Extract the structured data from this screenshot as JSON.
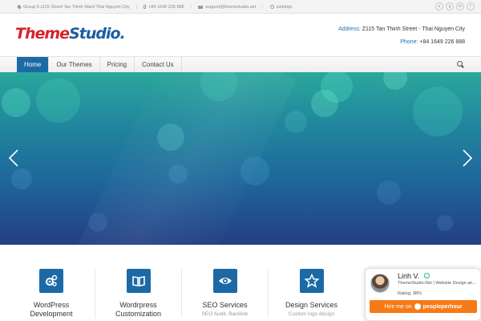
{
  "topbar": {
    "address": "Group 5 z115 Street Tan Thinh Ward Thai Nguyen City",
    "phone": "+84 1649 226 888",
    "email": "support@themestudio.net",
    "skype": "vulinhpc",
    "socials": [
      "skype",
      "google-plus",
      "linkedin",
      "facebook"
    ]
  },
  "header": {
    "logo_part1": "Theme",
    "logo_part2": "Studio.",
    "address_label": "Address:",
    "address_value": "Z115 Tan Thinh Street - Thai Nguyen City",
    "phone_label": "Phone:",
    "phone_value": "+84 1649 226 888"
  },
  "nav": {
    "items": [
      "Home",
      "Our Themes",
      "Pricing",
      "Contact Us"
    ],
    "active": "Home"
  },
  "slider": {
    "prev_icon": "chevron-left-icon",
    "next_icon": "chevron-right-icon"
  },
  "services": [
    {
      "title_line1": "WordPress",
      "title_line2": "Development",
      "desc": "",
      "icon": "gears-icon"
    },
    {
      "title_line1": "Wordrpress",
      "title_line2": "Customization",
      "desc": "",
      "icon": "book-icon"
    },
    {
      "title_line1": "SEO Services",
      "title_line2": "",
      "desc": "SEO Audit, Backlink",
      "icon": "eye-icon"
    },
    {
      "title_line1": "Design Services",
      "title_line2": "",
      "desc": "Custom logo design",
      "icon": "star-icon"
    }
  ],
  "widget": {
    "name": "Linh V.",
    "subtitle": "ThemeStudio.Net | Website Design an...",
    "rating": "Rating: 98%",
    "hire_label": "Hire me on",
    "brand": "peopleperhour"
  },
  "colors": {
    "brand_blue": "#1c6aa5",
    "logo_red": "#d9222a",
    "hire_orange": "#f77a16"
  }
}
